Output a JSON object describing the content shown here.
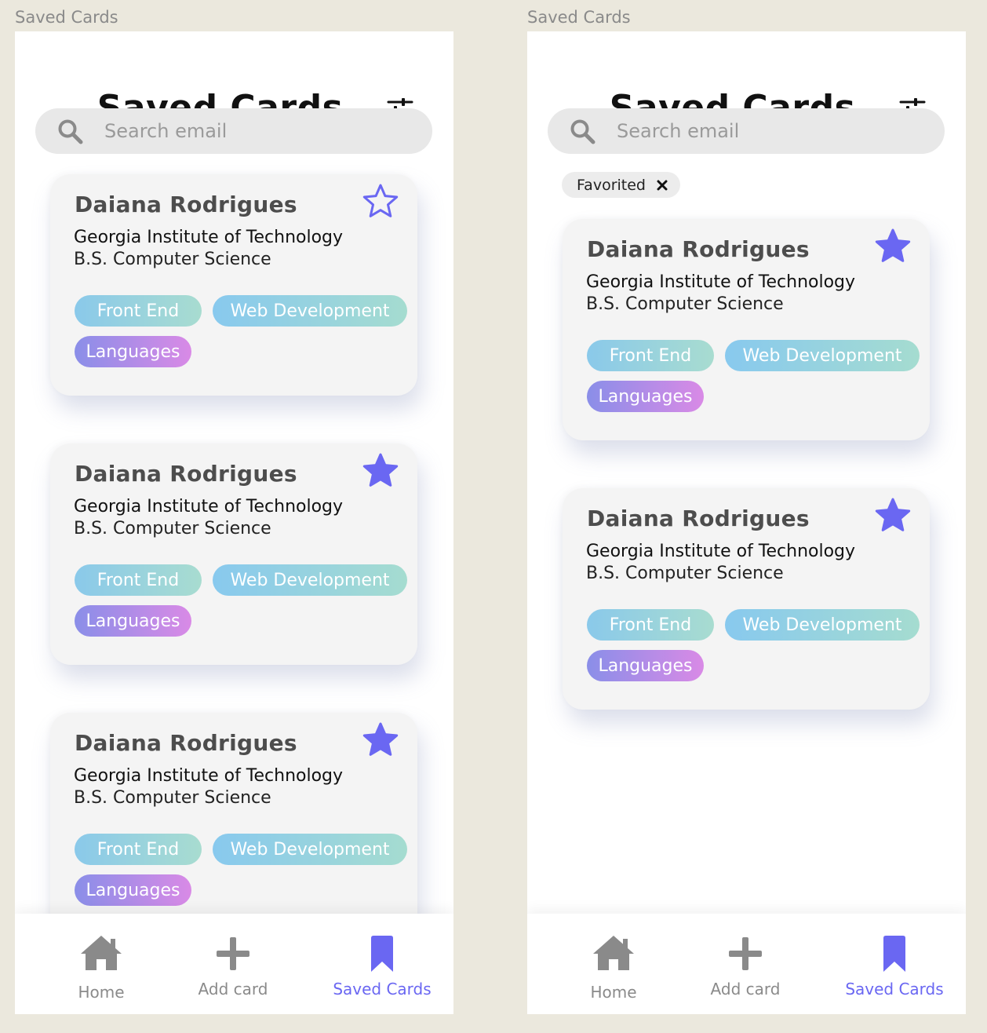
{
  "frames": [
    {
      "label": "Saved Cards",
      "title": "Saved Cards",
      "search_placeholder": "Search email",
      "cards": [
        {
          "name": "Daiana Rodrigues",
          "school": "Georgia Institute of Technology",
          "degree": "B.S. Computer Science",
          "favorited": false,
          "tags": [
            "Front End",
            "Web Development",
            "Languages"
          ]
        },
        {
          "name": "Daiana Rodrigues",
          "school": "Georgia Institute of Technology",
          "degree": "B.S. Computer Science",
          "favorited": true,
          "tags": [
            "Front End",
            "Web Development",
            "Languages"
          ]
        },
        {
          "name": "Daiana Rodrigues",
          "school": "Georgia Institute of Technology",
          "degree": "B.S. Computer Science",
          "favorited": true,
          "tags": [
            "Front End",
            "Web Development",
            "Languages"
          ]
        }
      ],
      "nav": {
        "home": "Home",
        "add": "Add card",
        "saved": "Saved Cards"
      }
    },
    {
      "label": "Saved Cards",
      "title": "Saved Cards",
      "search_placeholder": "Search email",
      "filter_chip": "Favorited",
      "cards": [
        {
          "name": "Daiana Rodrigues",
          "school": "Georgia Institute of Technology",
          "degree": "B.S. Computer Science",
          "favorited": true,
          "tags": [
            "Front End",
            "Web Development",
            "Languages"
          ]
        },
        {
          "name": "Daiana Rodrigues",
          "school": "Georgia Institute of Technology",
          "degree": "B.S. Computer Science",
          "favorited": true,
          "tags": [
            "Front End",
            "Web Development",
            "Languages"
          ]
        }
      ],
      "nav": {
        "home": "Home",
        "add": "Add card",
        "saved": "Saved Cards"
      }
    }
  ],
  "colors": {
    "accent": "#6a67f2",
    "nav_inactive": "#8a8a8a",
    "background": "#ebe8dd"
  },
  "icons": {
    "search": "search-icon",
    "filter": "sliders-icon",
    "favorite": "star-icon",
    "home": "home-icon",
    "add": "plus-icon",
    "saved": "bookmark-icon",
    "remove": "close-icon"
  }
}
